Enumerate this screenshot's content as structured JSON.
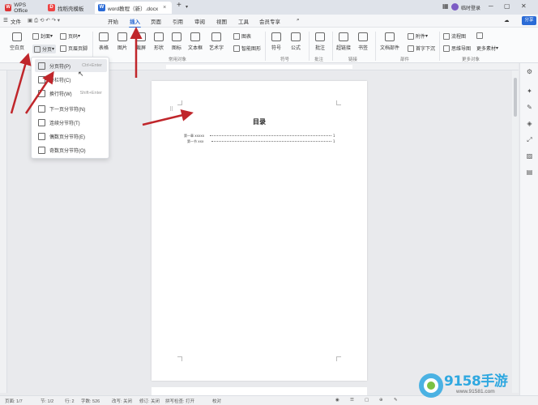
{
  "titlebar": {
    "tabs": [
      {
        "label": "WPS Office",
        "icon": "W"
      },
      {
        "label": "找稻壳模板",
        "icon": "D"
      },
      {
        "label": "word教程（新）.docx",
        "icon": "W",
        "active": true
      }
    ],
    "new_tab": "+",
    "login": "临时登录"
  },
  "menubar": {
    "file": "文件",
    "items": [
      "开始",
      "插入",
      "页面",
      "引用",
      "审阅",
      "视图",
      "工具",
      "会员专享"
    ],
    "share": "分享"
  },
  "ribbon": {
    "blank_page": "空白页",
    "cover": "封面",
    "page_code": "页码",
    "section": "分页",
    "header_footer": "页眉页脚",
    "table": "表格",
    "picture": "图片",
    "screenshot": "截屏",
    "shape": "形状",
    "icon": "图标",
    "textbox": "文本框",
    "wordart": "艺术字",
    "chart": "图表",
    "smart_shape": "智能图形",
    "symbol": "符号",
    "formula": "公式",
    "comment": "批注",
    "hyperlink": "超链接",
    "bookmark": "书签",
    "doc_parts": "文档部件",
    "attachment": "附件",
    "dropcap": "首字下沉",
    "flowchart": "流程图",
    "mindmap": "思维导图",
    "more_material": "更多素材",
    "groups": [
      "常用对象",
      "符号",
      "批注",
      "链接",
      "部件",
      "更多对象"
    ]
  },
  "dropdown": {
    "items": [
      {
        "label": "分页符(P)",
        "shortcut": "Ctrl+Enter"
      },
      {
        "label": "分栏符(C)",
        "shortcut": ""
      },
      {
        "label": "换行符(W)",
        "shortcut": "Shift+Enter"
      },
      {
        "label": "下一页分节符(N)",
        "shortcut": ""
      },
      {
        "label": "连续分节符(T)",
        "shortcut": ""
      },
      {
        "label": "偶数页分节符(E)",
        "shortcut": ""
      },
      {
        "label": "奇数页分节符(O)",
        "shortcut": ""
      }
    ]
  },
  "document": {
    "toc_title": "目录",
    "toc_entries": [
      {
        "label": "第一章 xxxxx",
        "page": "1"
      },
      {
        "label": "第一节 xxx",
        "page": "1"
      }
    ]
  },
  "statusbar": {
    "page": "页面: 1/7",
    "section": "节: 1/2",
    "line": "行: 2",
    "words": "字数: 526",
    "revision": "改写: 关闭",
    "track": "修订: 关闭",
    "spell": "拼写检查: 打开",
    "proofread": "校对"
  },
  "watermark": {
    "brand": "9158手游",
    "url": "www.91581.com"
  },
  "colors": {
    "accent": "#2b6bd6",
    "arrow": "#c0262b",
    "watermark": "#2fa8e0"
  }
}
